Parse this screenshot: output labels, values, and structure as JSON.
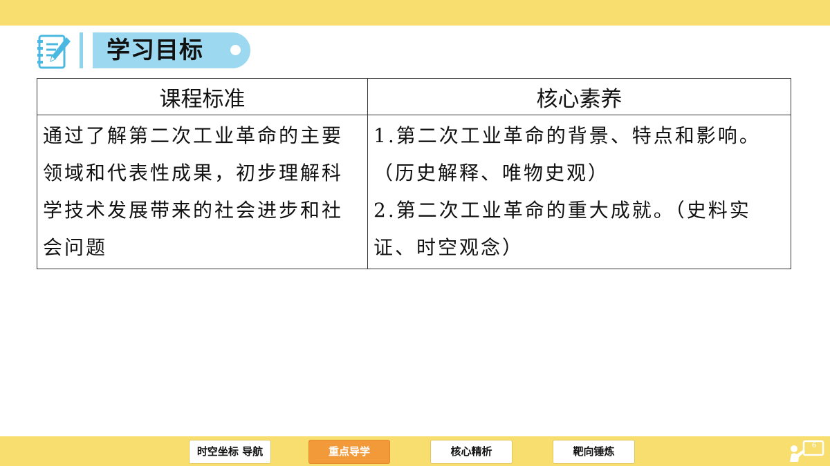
{
  "section": {
    "title": "学习目标",
    "icon": "notebook-pencil-icon"
  },
  "table": {
    "headers": [
      "课程标准",
      "核心素养"
    ],
    "standard": "通过了解第二次工业革命的主要领域和代表性成果，初步理解科学技术发展带来的社会进步和社会问题",
    "objectives": [
      "1.第二次工业革命的背景、特点和影响。（历史解释、唯物史观）",
      "2.第二次工业革命的重大成就。（史料实证、时空观念）"
    ]
  },
  "nav": {
    "buttons": [
      "时空坐标 导航",
      "重点导学",
      "核心精析",
      "靶向锤炼"
    ],
    "active": "重点导学"
  },
  "page_number": "6",
  "colors": {
    "bar": "#f7de6e",
    "title_pill": "#9cd8ef",
    "active_button": "#f29a3a"
  }
}
